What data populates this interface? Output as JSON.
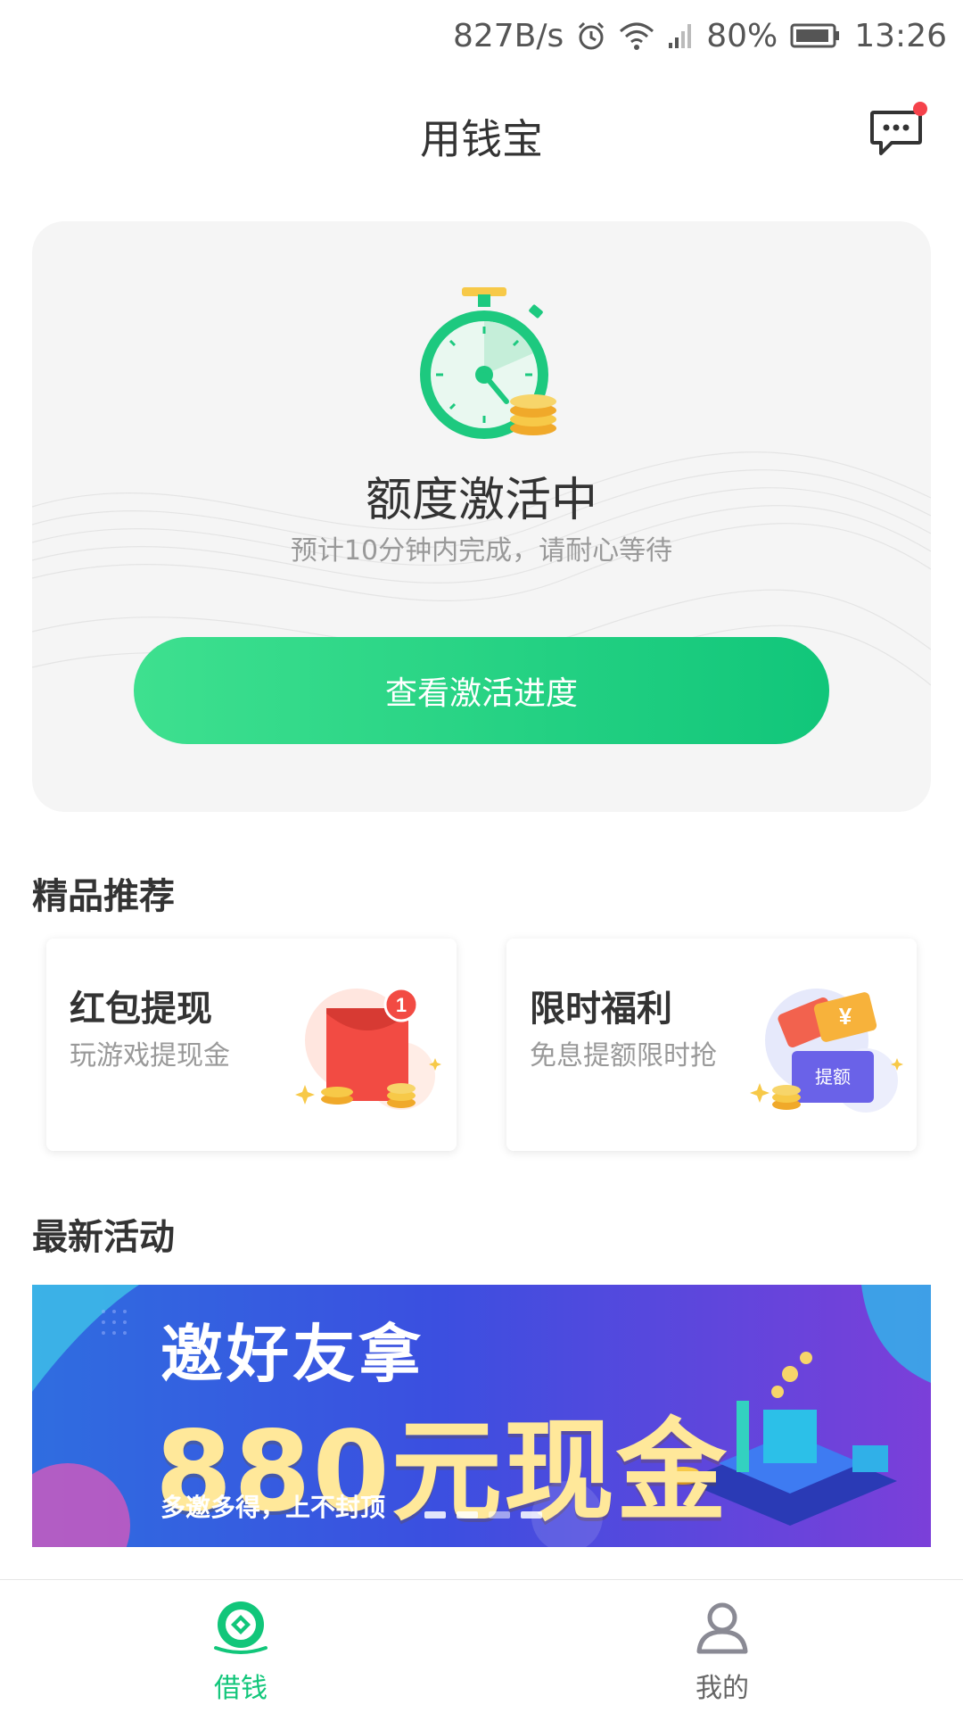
{
  "status_bar": {
    "net_speed": "827B/s",
    "battery": "80%",
    "time": "13:26",
    "icons": [
      "alarm-icon",
      "wifi-icon",
      "signal-icon",
      "battery-icon"
    ]
  },
  "header": {
    "title": "用钱宝",
    "message_icon": "chat-bubble-icon",
    "has_unread": true
  },
  "activation_card": {
    "title": "额度激活中",
    "subtitle": "预计10分钟内完成，请耐心等待",
    "button_label": "查看激活进度",
    "icon": "stopwatch-icon"
  },
  "sections": {
    "recommend_title": "精品推荐",
    "activity_title": "最新活动"
  },
  "promos": [
    {
      "title": "红包提现",
      "subtitle": "玩游戏提现金",
      "icon": "red-envelope-icon",
      "badge": "1"
    },
    {
      "title": "限时福利",
      "subtitle": "免息提额限时抢",
      "icon": "coupon-icon",
      "badge_text": "提额"
    }
  ],
  "banner": {
    "line1": "邀好友拿",
    "line2": "880元现金",
    "line3": "多邀多得，上不封顶",
    "dots": 4
  },
  "bottom_nav": [
    {
      "label": "借钱",
      "icon": "coin-icon",
      "active": true
    },
    {
      "label": "我的",
      "icon": "user-icon",
      "active": false
    }
  ],
  "colors": {
    "accent": "#11c67a",
    "accent_light": "#3ee08f",
    "card_bg": "#f5f5f5",
    "unread_dot": "#f5424b"
  }
}
